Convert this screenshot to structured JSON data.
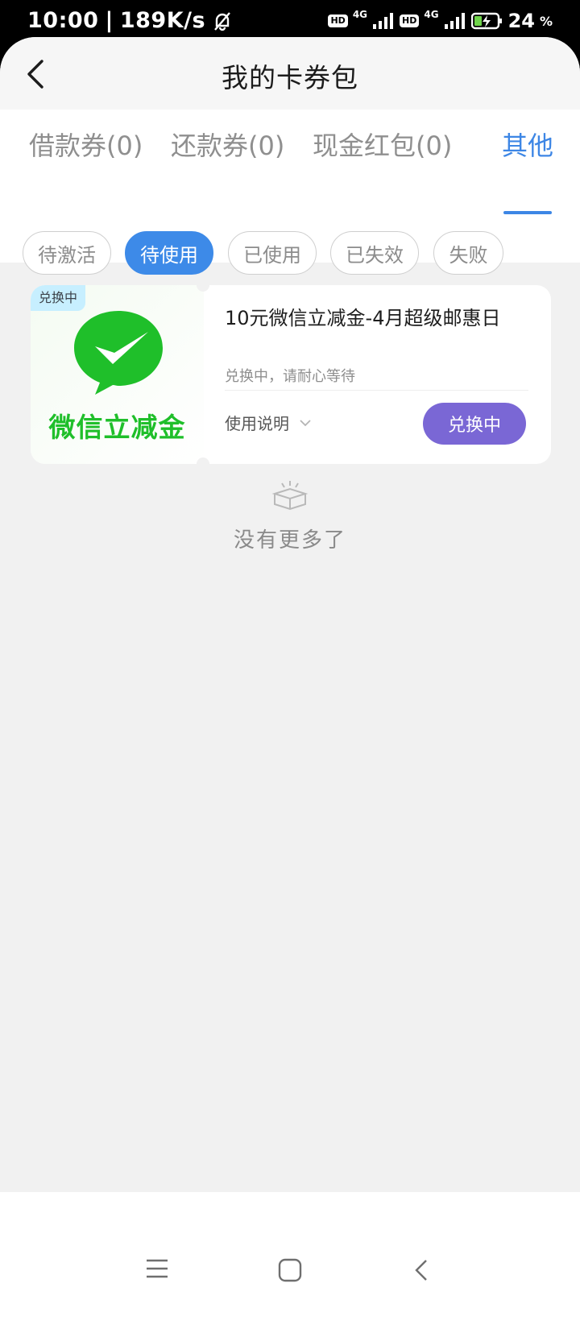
{
  "status_bar": {
    "time": "10:00",
    "separator": "|",
    "speed": "189K/s",
    "hd_badge": "HD",
    "network_type": "4G",
    "battery": "24",
    "battery_unit": "%"
  },
  "header": {
    "title": "我的卡券包"
  },
  "tabs": [
    {
      "label": "借款券(0)"
    },
    {
      "label": "还款券(0)"
    },
    {
      "label": "现金红包(0)"
    },
    {
      "label": "其他"
    }
  ],
  "filters": [
    {
      "label": "待激活"
    },
    {
      "label": "待使用"
    },
    {
      "label": "已使用"
    },
    {
      "label": "已失效"
    },
    {
      "label": "失败"
    }
  ],
  "coupon": {
    "badge": "兑换中",
    "image_label": "微信立减金",
    "title": "10元微信立减金-4月超级邮惠日",
    "status_text": "兑换中，请耐心等待",
    "usage_label": "使用说明",
    "button_label": "兑换中"
  },
  "empty_state": {
    "text": "没有更多了"
  },
  "colors": {
    "accent": "#3d86e5",
    "exchange_button": "#7a67d5",
    "wechat_green": "#1fbf2a"
  }
}
